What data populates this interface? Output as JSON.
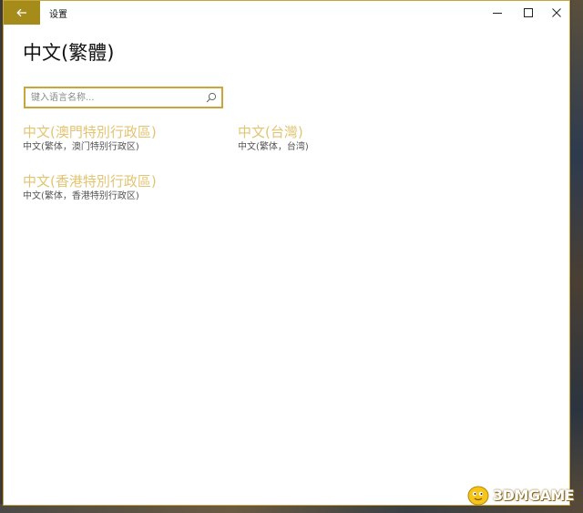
{
  "window": {
    "title": "设置",
    "back_icon": "arrow-left-icon",
    "controls": [
      "minimize-icon",
      "maximize-icon",
      "close-icon"
    ]
  },
  "page": {
    "title": "中文(繁體)"
  },
  "search": {
    "placeholder": "键入语言名称...",
    "value": "",
    "icon": "search-icon"
  },
  "languages": [
    {
      "name": "中文(澳門特別行政區)",
      "sub": "中文(繁体，澳门特别行政区)"
    },
    {
      "name": "中文(台灣)",
      "sub": "中文(繁体，台湾)"
    },
    {
      "name": "中文(香港特別行政區)",
      "sub": "中文(繁体，香港特别行政区)"
    }
  ],
  "watermark": {
    "text": "3DMGAME"
  },
  "colors": {
    "accent": "#a58b1a",
    "border": "#c9a63a",
    "language_name": "#e2c472"
  }
}
